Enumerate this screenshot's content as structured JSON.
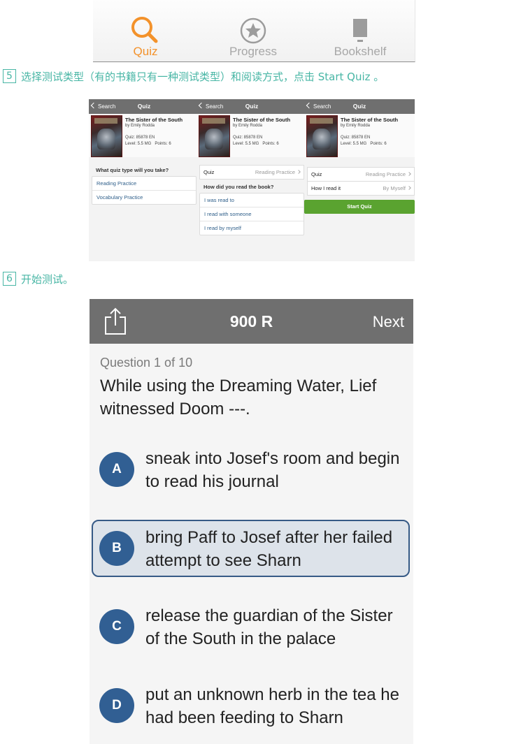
{
  "tabbar": {
    "tabs": [
      {
        "label": "Quiz",
        "icon": "search-icon",
        "active": true
      },
      {
        "label": "Progress",
        "icon": "star-icon",
        "active": false
      },
      {
        "label": "Bookshelf",
        "icon": "book-icon",
        "active": false
      }
    ],
    "active_color": "#f3922b",
    "inactive_color": "#a7a7a7"
  },
  "steps": [
    {
      "num": "5",
      "text": "选择测试类型（有的书籍只有一种测试类型）和阅读方式，点击 Start Quiz 。"
    },
    {
      "num": "6",
      "text": "开始测试。"
    }
  ],
  "mini_screens": {
    "back_label": "Search",
    "title": "Quiz",
    "book": {
      "title": "The Sister of the South",
      "author": "by Emily Rodda",
      "quiz": "Quiz: 85878 EN",
      "level": "Level: 5.5 MG",
      "points": "Points: 6"
    },
    "screen1": {
      "question": "What quiz type will you take?",
      "options": [
        "Reading Practice",
        "Vocabulary Practice"
      ]
    },
    "screen2": {
      "row_label": "Quiz",
      "row_value": "Reading Practice",
      "question": "How did you read the book?",
      "options": [
        "I was read to",
        "I read with someone",
        "I read by myself"
      ]
    },
    "screen3": {
      "row1_label": "Quiz",
      "row1_value": "Reading Practice",
      "row2_label": "How I read it",
      "row2_value": "By Myself",
      "button": "Start Quiz"
    },
    "accent_green": "#5aa330"
  },
  "quiz": {
    "level": "900 R",
    "next_label": "Next",
    "counter": "Question 1 of 10",
    "question": "While using the Dreaming Water, Lief witnessed Doom ---.",
    "answers": [
      {
        "letter": "A",
        "text": "sneak into Josef's room and begin to read his journal",
        "selected": false
      },
      {
        "letter": "B",
        "text": "bring Paff to Josef after her failed attempt to see Sharn",
        "selected": true
      },
      {
        "letter": "C",
        "text": "release the guardian of the Sister of the South in the palace",
        "selected": false
      },
      {
        "letter": "D",
        "text": "put an unknown herb in the tea he had been feeding to Sharn",
        "selected": false
      }
    ],
    "circle_color": "#315f93",
    "selected_border": "#365a86"
  }
}
